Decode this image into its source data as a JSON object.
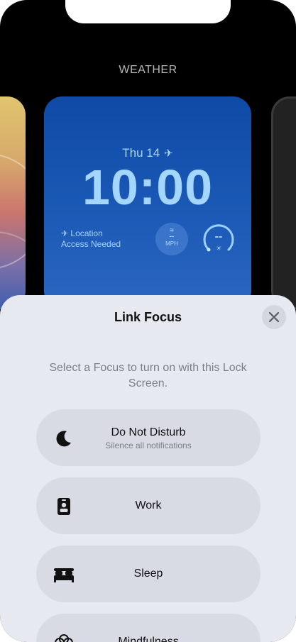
{
  "header": {
    "section_title": "WEATHER"
  },
  "lock_screen": {
    "date": "Thu 14",
    "time": "10:00",
    "location_line1": "Location",
    "location_line2": "Access Needed",
    "wind_value": "--",
    "wind_unit": "MPH",
    "uv_value": "--"
  },
  "sheet": {
    "title": "Link Focus",
    "subtitle": "Select a Focus to turn on with this Lock Screen.",
    "options": [
      {
        "label": "Do Not Disturb",
        "sublabel": "Silence all notifications",
        "icon": "moon-icon"
      },
      {
        "label": "Work",
        "icon": "id-badge-icon"
      },
      {
        "label": "Sleep",
        "icon": "bed-icon"
      },
      {
        "label": "Mindfulness",
        "icon": "flower-icon"
      }
    ]
  },
  "colors": {
    "sheet_bg": "#e6e9f0",
    "option_bg": "#d8dbe3",
    "lock_card_blue": "#1a58b5",
    "lock_text": "#a5d6ff"
  }
}
